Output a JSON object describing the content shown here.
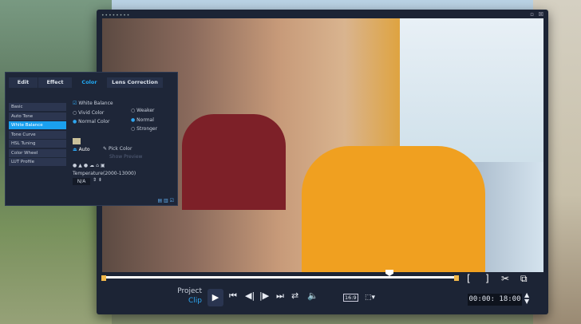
{
  "panel": {
    "tabs": [
      "Edit",
      "Effect",
      "Color",
      "Lens Correction"
    ],
    "active_tab": "Color",
    "menu": [
      "Basic",
      "Auto Tone",
      "White Balance",
      "Tone Curve",
      "HSL Tuning",
      "Color Wheel",
      "LUT Profile"
    ],
    "active_menu": "White Balance",
    "white_balance": "White Balance",
    "vivid": "Vivid Color",
    "normal_color": "Normal Color",
    "weaker": "Weaker",
    "normal": "Normal",
    "stronger": "Stronger",
    "auto": "Auto",
    "pick_color": "Pick Color",
    "show_preview": "Show Preview",
    "temperature_label": "Temperature(2000-13000)",
    "temperature_value": "N/A"
  },
  "player": {
    "project_label": "Project",
    "clip_label": "Clip",
    "aspect": "16:9",
    "timecode": "00:00: 18:00",
    "scrub_position": 0.81,
    "icons": [
      "play",
      "go-start",
      "step-back",
      "step-forward",
      "go-end",
      "repeat",
      "volume"
    ]
  }
}
